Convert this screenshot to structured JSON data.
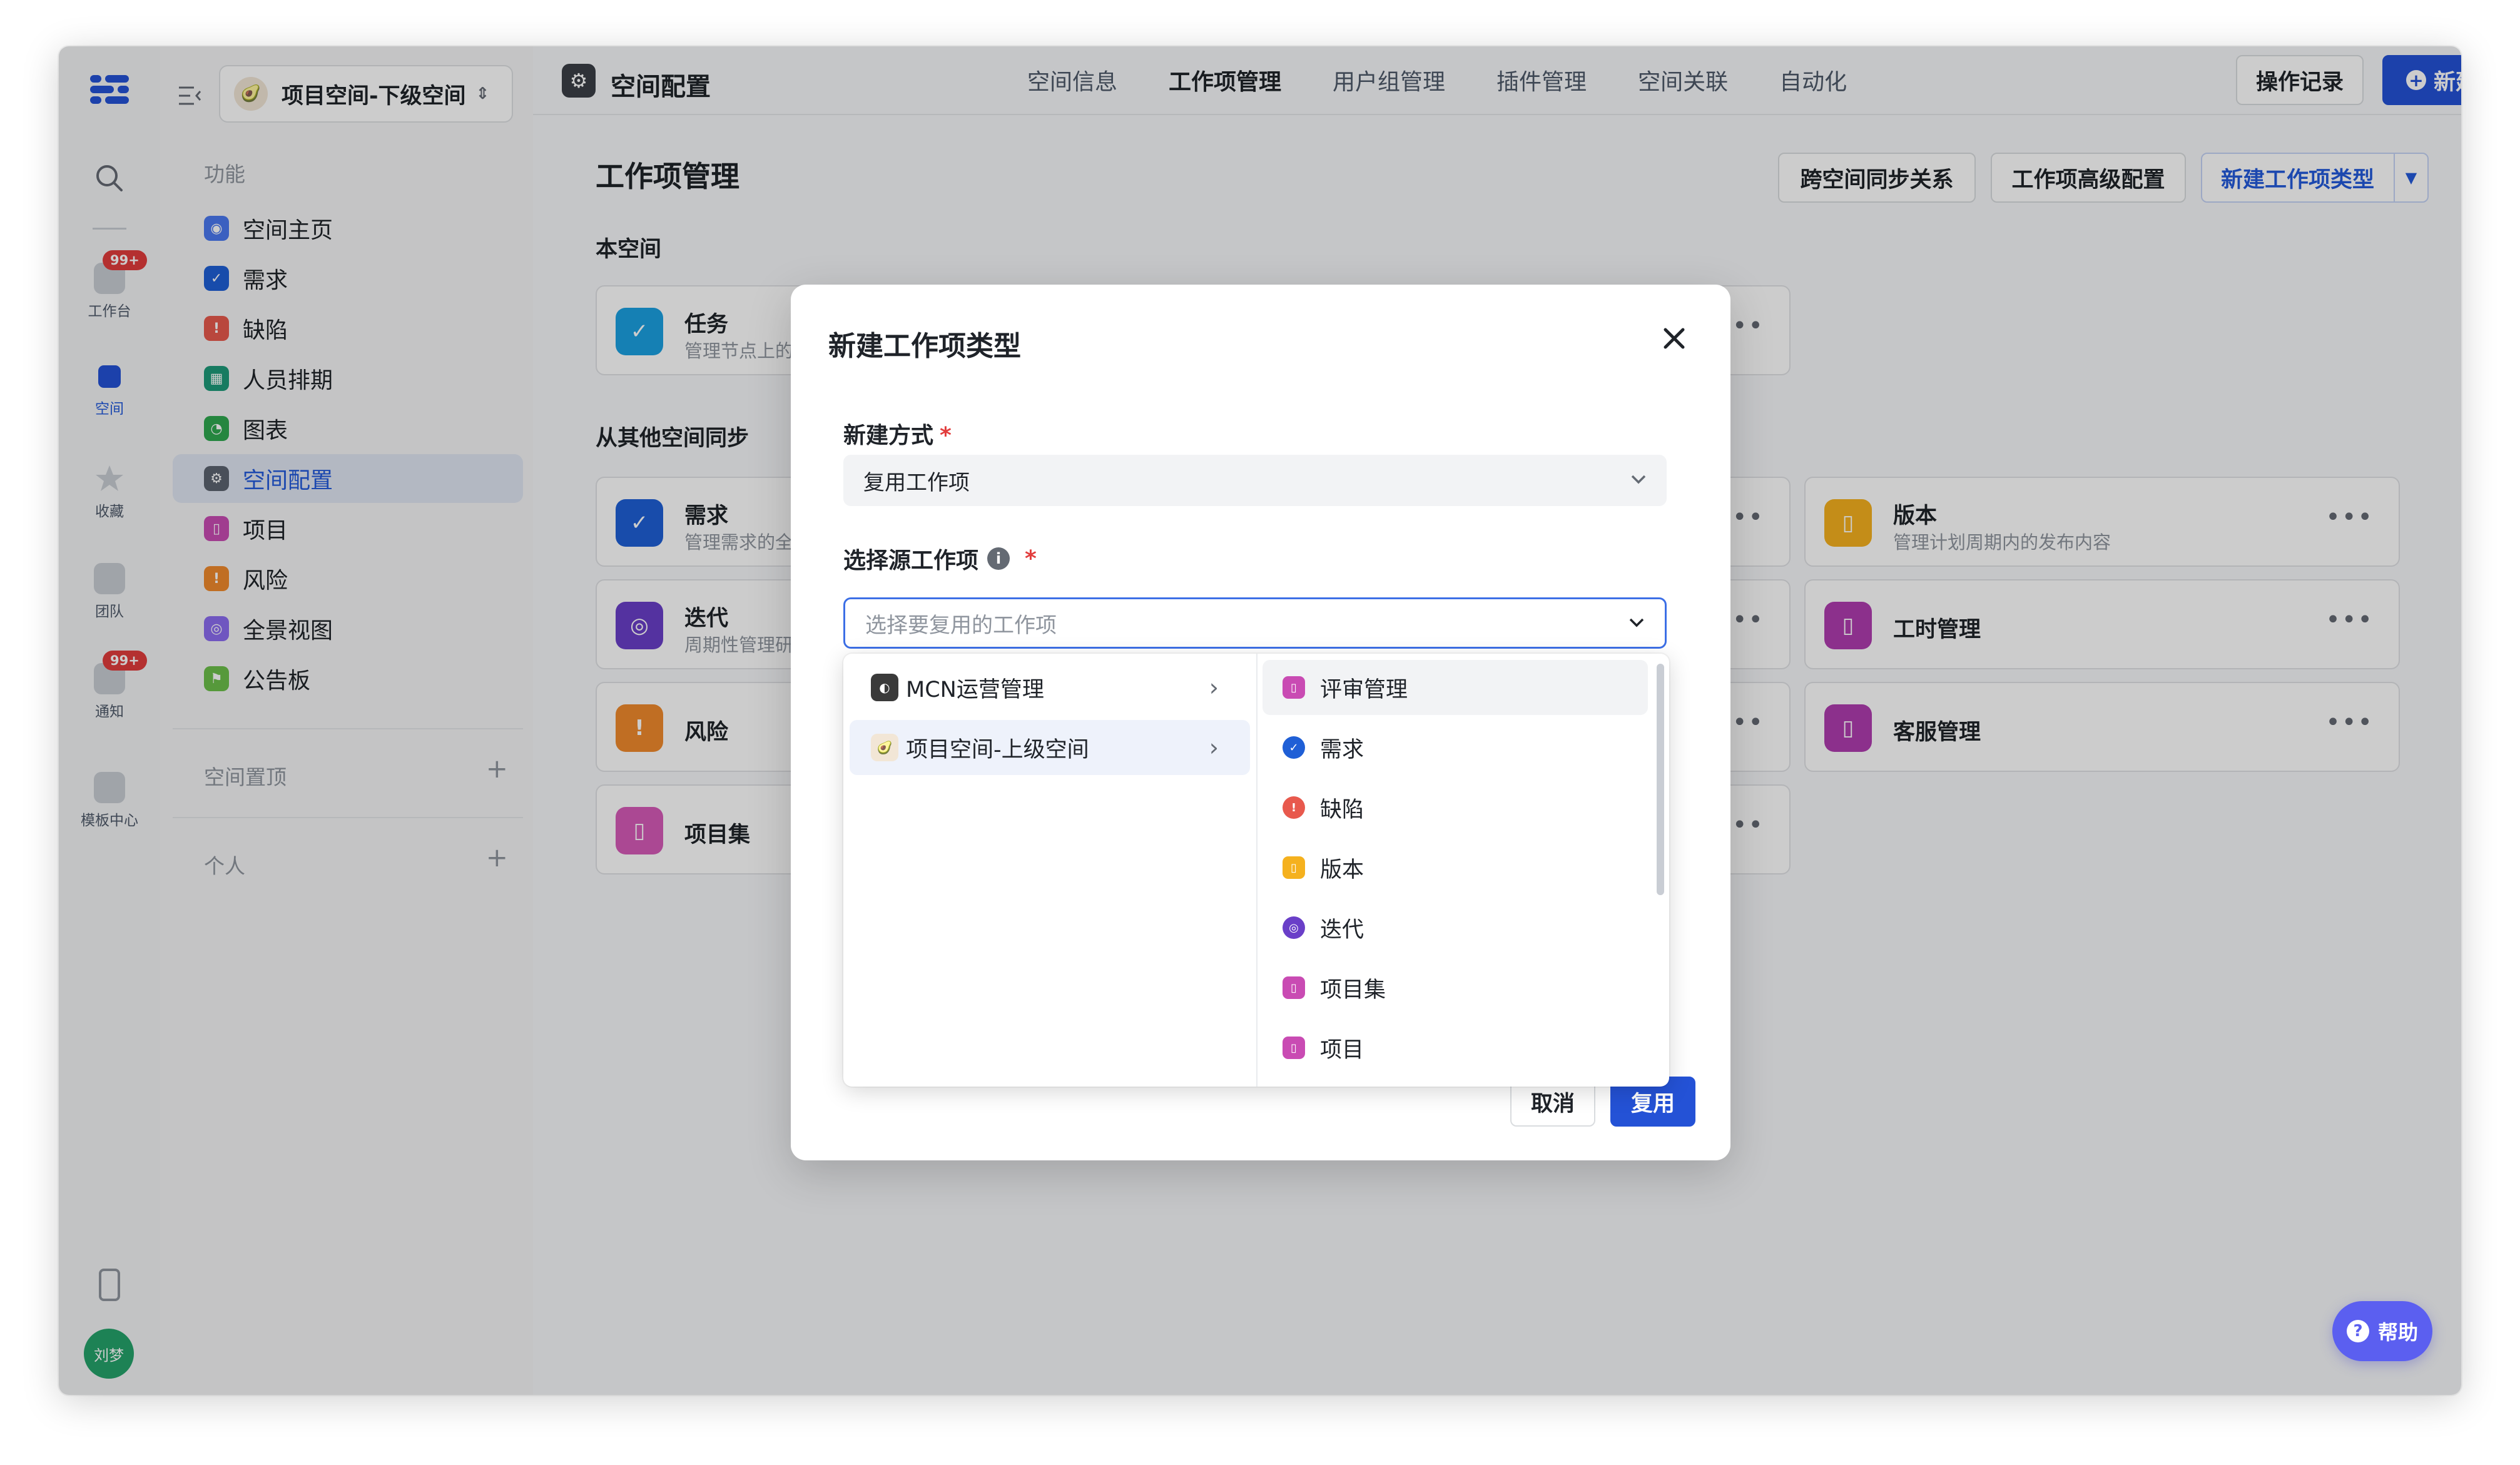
{
  "rail": {
    "badge": "99+",
    "items": [
      {
        "label": "工作台",
        "icon": "home-icon"
      },
      {
        "label": "空间",
        "icon": "space-icon"
      },
      {
        "label": "收藏",
        "icon": "star-icon"
      },
      {
        "label": "团队",
        "icon": "team-icon"
      },
      {
        "label": "通知",
        "icon": "bell-icon"
      },
      {
        "label": "模板中心",
        "icon": "template-icon"
      }
    ],
    "avatar": "刘梦"
  },
  "sidebar": {
    "space_name": "项目空间-下级空间",
    "section_label": "功能",
    "items": [
      {
        "label": "空间主页",
        "color": "#4a78f0"
      },
      {
        "label": "需求",
        "color": "#1f5fd6"
      },
      {
        "label": "缺陷",
        "color": "#e8594d"
      },
      {
        "label": "人员排期",
        "color": "#1d9a7a"
      },
      {
        "label": "图表",
        "color": "#2fa84f"
      },
      {
        "label": "空间配置",
        "color": "#5c6370"
      },
      {
        "label": "项目",
        "color": "#c94bb3"
      },
      {
        "label": "风险",
        "color": "#f08a2c"
      },
      {
        "label": "全景视图",
        "color": "#8b6cf0"
      },
      {
        "label": "公告板",
        "color": "#6cc04a"
      }
    ],
    "pinned_label": "空间置顶",
    "personal_label": "个人"
  },
  "topbar": {
    "title": "空间配置",
    "tabs": [
      "空间信息",
      "工作项管理",
      "用户组管理",
      "插件管理",
      "空间关联",
      "自动化"
    ],
    "active_tab": "工作项管理",
    "log_button": "操作记录",
    "new_button": "新建"
  },
  "page": {
    "title": "工作项管理",
    "sync_button": "跨空间同步关系",
    "advanced_button": "工作项高级配置",
    "new_type_button": "新建工作项类型",
    "this_space_label": "本空间",
    "other_space_label": "从其他空间同步",
    "cards": [
      {
        "title": "任务",
        "desc": "管理节点上的",
        "color": "#1ba0e2"
      },
      {
        "title": "需求",
        "desc": "管理需求的全",
        "color": "#1f5fd6"
      },
      {
        "title": "迭代",
        "desc": "周期性管理研",
        "color": "#6a3fc8"
      },
      {
        "title": "风险",
        "desc": "",
        "color": "#f08a2c"
      },
      {
        "title": "项目集",
        "desc": "",
        "color": "#d65bb8"
      },
      {
        "title": "版本",
        "desc": "管理计划周期内的发布内容",
        "color": "#f5b11e"
      },
      {
        "title": "工时管理",
        "desc": "",
        "color": "#b03db0"
      },
      {
        "title": "客服管理",
        "desc": "",
        "color": "#b03db0"
      }
    ]
  },
  "modal": {
    "title": "新建工作项类型",
    "method_label": "新建方式",
    "method_value": "复用工作项",
    "source_label": "选择源工作项",
    "source_placeholder": "选择要复用的工作项",
    "cancel_button": "取消",
    "confirm_button": "复用",
    "spaces": [
      {
        "name": "MCN运营管理"
      },
      {
        "name": "项目空间-上级空间"
      }
    ],
    "items": [
      {
        "name": "评审管理",
        "color": "#c94bb3"
      },
      {
        "name": "需求",
        "color": "#1f5fd6"
      },
      {
        "name": "缺陷",
        "color": "#e8594d"
      },
      {
        "name": "版本",
        "color": "#f5b11e"
      },
      {
        "name": "迭代",
        "color": "#6a3fc8"
      },
      {
        "name": "项目集",
        "color": "#c94bb3"
      },
      {
        "name": "项目",
        "color": "#c94bb3"
      }
    ]
  },
  "help": {
    "label": "帮助"
  }
}
